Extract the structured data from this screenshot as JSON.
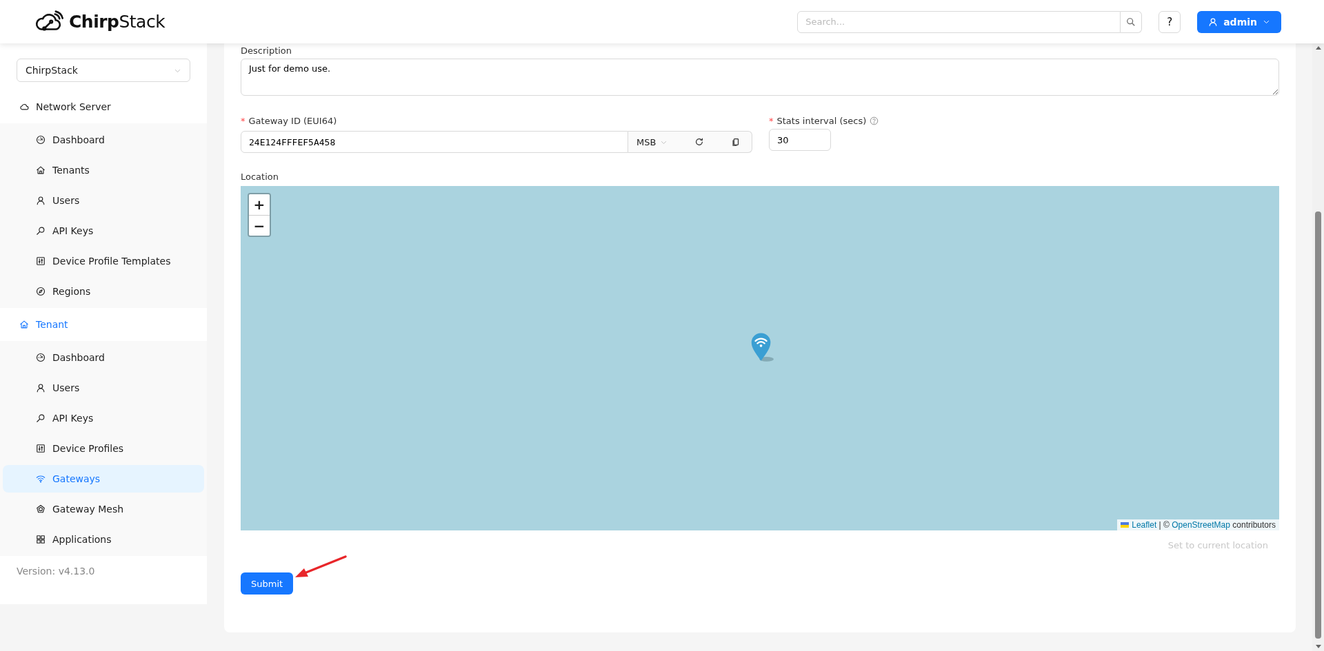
{
  "header": {
    "logo": "**Chirp**Stack",
    "search": {
      "placeholder": "Search..."
    },
    "help": "?",
    "user": "admin"
  },
  "sidebar": {
    "tenant_select": "ChirpStack",
    "groups": [
      {
        "label": "Network Server",
        "kind": "cloud",
        "selected": false,
        "items": [
          {
            "label": "Dashboard",
            "kind": "gauge",
            "selected": false
          },
          {
            "label": "Tenants",
            "kind": "home",
            "selected": false
          },
          {
            "label": "Users",
            "kind": "user",
            "selected": false
          },
          {
            "label": "API Keys",
            "kind": "key",
            "selected": false
          },
          {
            "label": "Device Profile Templates",
            "kind": "sliders",
            "selected": false
          },
          {
            "label": "Regions",
            "kind": "compass",
            "selected": false
          }
        ]
      },
      {
        "label": "Tenant",
        "kind": "home",
        "selected": true,
        "items": [
          {
            "label": "Dashboard",
            "kind": "gauge",
            "selected": false
          },
          {
            "label": "Users",
            "kind": "user",
            "selected": false
          },
          {
            "label": "API Keys",
            "kind": "key",
            "selected": false
          },
          {
            "label": "Device Profiles",
            "kind": "sliders",
            "selected": false
          },
          {
            "label": "Gateways",
            "kind": "wifi",
            "selected": true
          },
          {
            "label": "Gateway Mesh",
            "kind": "mesh",
            "selected": false
          },
          {
            "label": "Applications",
            "kind": "grid",
            "selected": false
          }
        ]
      }
    ],
    "version": "Version: v4.13.0"
  },
  "form": {
    "description": {
      "label": "Description",
      "value": "Just for demo use."
    },
    "gateway_id": {
      "label": "Gateway ID (EUI64)",
      "required_mark": "*",
      "value": "24E124FFFEF5A458",
      "byte_order": "MSB"
    },
    "stats_interval": {
      "label": "Stats interval (secs)",
      "required_mark": "*",
      "value": "30"
    },
    "location": {
      "label": "Location",
      "zoom_in": "+",
      "zoom_out": "−",
      "attribution": {
        "leaflet": "Leaflet",
        "separator": "| ©",
        "osm": "OpenStreetMap",
        "suffix": "contributors"
      }
    },
    "set_location": {
      "label": "Set to current location",
      "disabled": true
    },
    "submit": "Submit"
  }
}
